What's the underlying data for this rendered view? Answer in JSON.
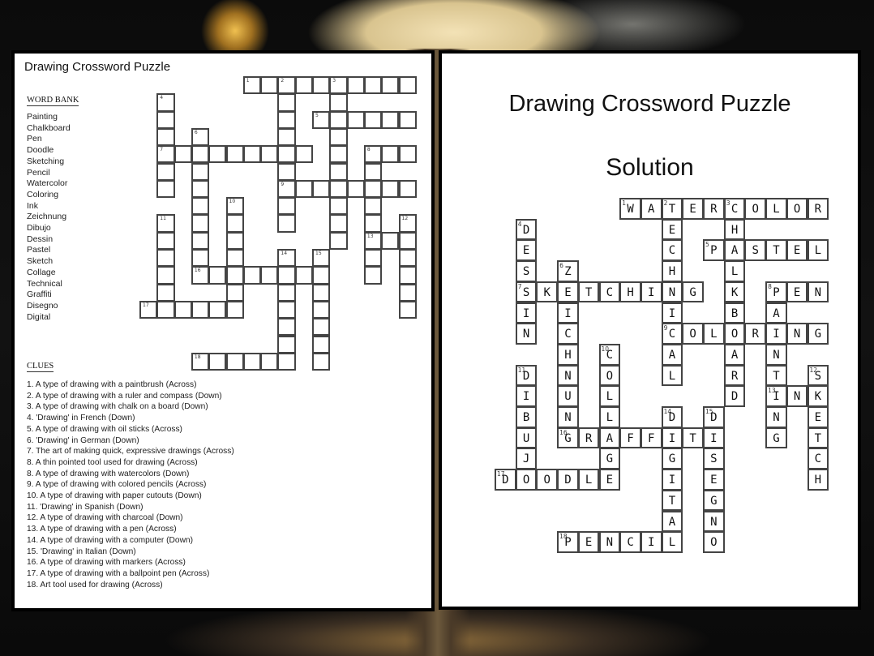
{
  "puzzle": {
    "title": "Drawing Crossword Puzzle",
    "word_bank_heading": "WORD BANK",
    "word_bank": [
      "Painting",
      "Chalkboard",
      "Pen",
      "Doodle",
      "Sketching",
      "Pencil",
      "Watercolor",
      "Coloring",
      "Ink",
      "Zeichnung",
      "Dibujo",
      "Dessin",
      "Pastel",
      "Sketch",
      "Collage",
      "Technical",
      "Graffiti",
      "Disegno",
      "Digital"
    ],
    "clues_heading": "CLUES",
    "clues": [
      "1. A type of drawing with a paintbrush (Across)",
      "2. A type of drawing with a ruler and compass (Down)",
      "3. A type of drawing with chalk on a board (Down)",
      "4. 'Drawing' in French (Down)",
      "5. A type of drawing with oil sticks (Across)",
      "6. 'Drawing' in German (Down)",
      "7. The art of making quick, expressive drawings (Across)",
      "8. A thin pointed tool used for drawing (Across)",
      "8. A type of drawing with watercolors (Down)",
      "9. A type of drawing with colored pencils (Across)",
      "10. A type of drawing with paper cutouts (Down)",
      "11. 'Drawing' in Spanish (Down)",
      "12. A type of drawing with charcoal (Down)",
      "13. A type of drawing with a pen (Across)",
      "14. A type of drawing with a computer  (Down)",
      "15. 'Drawing' in Italian (Down)",
      "16. A type of drawing with markers (Across)",
      "17. A type of drawing with a ballpoint pen (Across)",
      "18. Art tool used for drawing (Across)"
    ]
  },
  "solution": {
    "title": "Drawing Crossword Puzzle",
    "subtitle": "Solution"
  },
  "grid_words": [
    {
      "num": 1,
      "answer": "WATERCOLOR",
      "dir": "across",
      "row": 0,
      "col": 6
    },
    {
      "num": 2,
      "answer": "TECHNICAL",
      "dir": "down",
      "row": 0,
      "col": 8
    },
    {
      "num": 3,
      "answer": "CHALKBOARD",
      "dir": "down",
      "row": 0,
      "col": 11
    },
    {
      "num": 4,
      "answer": "DESSIN",
      "dir": "down",
      "row": 1,
      "col": 1
    },
    {
      "num": 5,
      "answer": "PASTEL",
      "dir": "across",
      "row": 2,
      "col": 10
    },
    {
      "num": 6,
      "answer": "ZEICHNUNG",
      "dir": "down",
      "row": 3,
      "col": 3
    },
    {
      "num": 7,
      "answer": "SKETCHING",
      "dir": "across",
      "row": 4,
      "col": 1
    },
    {
      "num": 8,
      "answer": "PEN",
      "dir": "across",
      "row": 4,
      "col": 13
    },
    {
      "num": 8,
      "answer": "PAINTING",
      "dir": "down",
      "row": 4,
      "col": 13
    },
    {
      "num": 9,
      "answer": "COLORING",
      "dir": "across",
      "row": 6,
      "col": 8
    },
    {
      "num": 10,
      "answer": "COLLAGE",
      "dir": "down",
      "row": 7,
      "col": 5
    },
    {
      "num": 11,
      "answer": "DIBUJO",
      "dir": "down",
      "row": 8,
      "col": 1
    },
    {
      "num": 12,
      "answer": "SKETCH",
      "dir": "down",
      "row": 8,
      "col": 15
    },
    {
      "num": 13,
      "answer": "INK",
      "dir": "across",
      "row": 9,
      "col": 13
    },
    {
      "num": 14,
      "answer": "DIGITAL",
      "dir": "down",
      "row": 10,
      "col": 8
    },
    {
      "num": 15,
      "answer": "DISEGNO",
      "dir": "down",
      "row": 10,
      "col": 10
    },
    {
      "num": 16,
      "answer": "GRAFFITI",
      "dir": "across",
      "row": 11,
      "col": 3
    },
    {
      "num": 17,
      "answer": "DOODLE",
      "dir": "across",
      "row": 13,
      "col": 0
    },
    {
      "num": 18,
      "answer": "PENCIL",
      "dir": "across",
      "row": 16,
      "col": 3
    }
  ]
}
